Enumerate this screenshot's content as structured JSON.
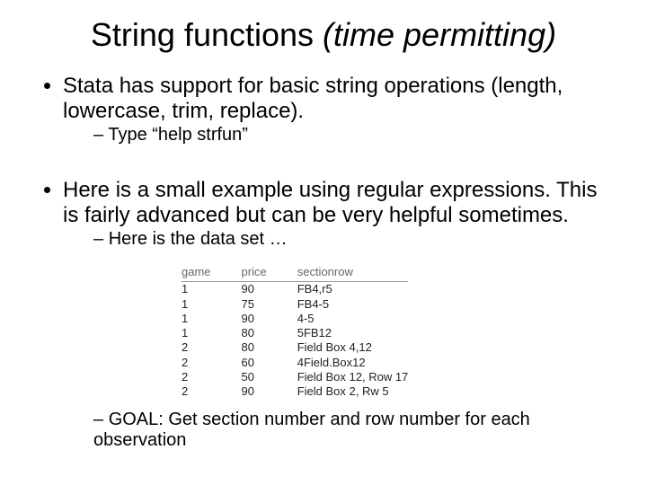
{
  "title": {
    "plain": "String functions ",
    "italic": "(time permitting)"
  },
  "bullets": {
    "b1": "Stata has support for basic string operations (length, lowercase, trim, replace).",
    "b1_sub1": "Type “help strfun”",
    "b2": "Here is a small example using regular expressions.  This is fairly advanced but can be very helpful sometimes.",
    "b2_sub1": "Here is the data set …",
    "b2_sub2": "GOAL: Get section number and row number for each observation"
  },
  "table": {
    "headers": {
      "game": "game",
      "price": "price",
      "sectionrow": "sectionrow"
    },
    "rows": [
      {
        "game": "1",
        "price": "90",
        "sectionrow": "FB4,r5"
      },
      {
        "game": "1",
        "price": "75",
        "sectionrow": "FB4-5"
      },
      {
        "game": "1",
        "price": "90",
        "sectionrow": "4-5"
      },
      {
        "game": "1",
        "price": "80",
        "sectionrow": "5FB12"
      },
      {
        "game": "2",
        "price": "80",
        "sectionrow": "Field Box 4,12"
      },
      {
        "game": "2",
        "price": "60",
        "sectionrow": "4Field.Box12"
      },
      {
        "game": "2",
        "price": "50",
        "sectionrow": "Field Box 12, Row 17"
      },
      {
        "game": "2",
        "price": "90",
        "sectionrow": "Field Box 2, Rw 5"
      }
    ]
  }
}
